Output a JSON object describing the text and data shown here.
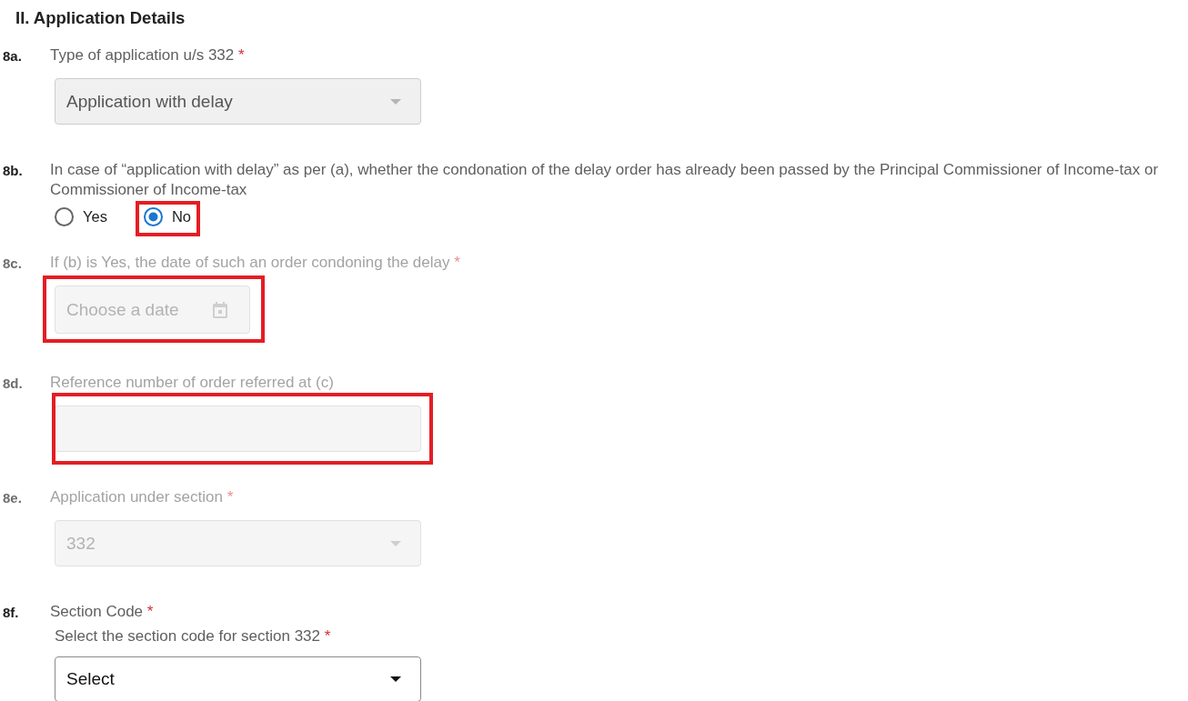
{
  "section": {
    "title": "II. Application Details"
  },
  "questions": [
    {
      "number": "8a.",
      "label": "Type of application u/s 332",
      "required_mark": "*",
      "disabled": false,
      "control": {
        "kind": "select",
        "value": "Application with delay",
        "readonly": true,
        "highlighted": false
      }
    },
    {
      "number": "8b.",
      "label": "In case of “application with delay” as per (a), whether the condonation of the delay order has already been passed by the Principal Commissioner of Income-tax or Commissioner of Income-tax",
      "disabled": false,
      "control": {
        "kind": "radio",
        "options": [
          {
            "label": "Yes",
            "selected": false,
            "highlighted": false
          },
          {
            "label": "No",
            "selected": true,
            "highlighted": true
          }
        ]
      }
    },
    {
      "number": "8c.",
      "label": "If (b) is Yes, the date of such an order condoning the delay",
      "required_mark": "*",
      "disabled": true,
      "control": {
        "kind": "date",
        "placeholder": "Choose a date",
        "highlighted": true
      }
    },
    {
      "number": "8d.",
      "label": "Reference number of order referred at (c)",
      "disabled": true,
      "control": {
        "kind": "text",
        "highlighted": true
      }
    },
    {
      "number": "8e.",
      "label": "Application under section",
      "required_mark": "*",
      "disabled": true,
      "control": {
        "kind": "select",
        "value": "332",
        "readonly": false,
        "highlighted": false
      }
    },
    {
      "number": "8f.",
      "label": "Section Code",
      "required_mark": "*",
      "disabled": false,
      "control": {
        "kind": "select",
        "sublabel": "Select the section code for section 332",
        "sublabel_required_mark": "*",
        "value": "Select",
        "readonly": false,
        "highlighted": false
      }
    }
  ]
}
